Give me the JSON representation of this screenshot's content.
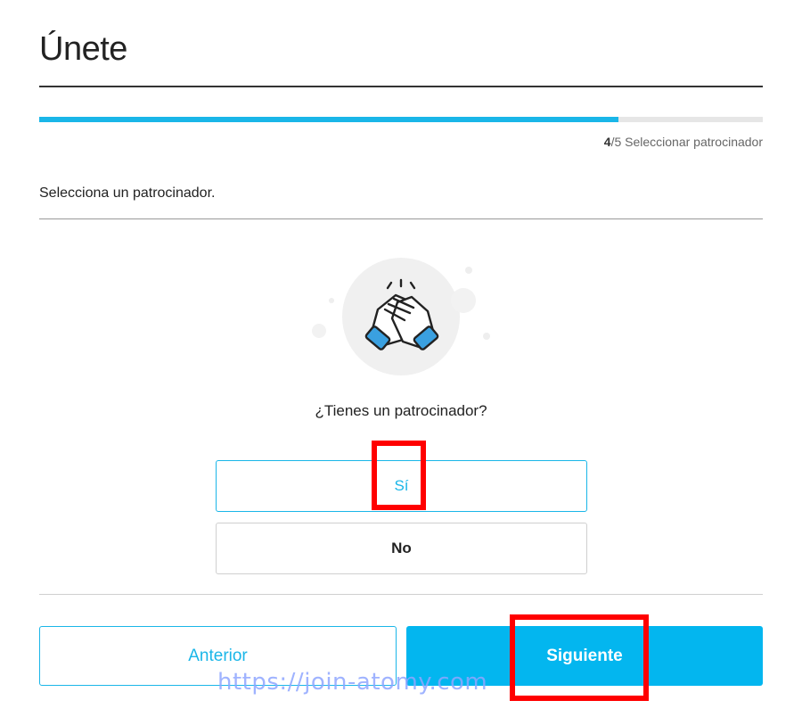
{
  "header": {
    "title": "Únete"
  },
  "progress": {
    "value": 0.8,
    "step_current": "4",
    "step_total": "/5 Seleccionar patrocinador"
  },
  "instruction": "Selecciona un patrocinador.",
  "illustration": {
    "icon": "handshake-icon"
  },
  "question": "¿Tienes un patrocinador?",
  "options": {
    "yes_label": "Sí",
    "no_label": "No"
  },
  "footer": {
    "prev_label": "Anterior",
    "next_label": "Siguiente"
  },
  "watermark": "https://join-atomy.com",
  "colors": {
    "accent": "#1ab6e8",
    "button": "#03b6ef",
    "highlight": "#ff0000"
  }
}
